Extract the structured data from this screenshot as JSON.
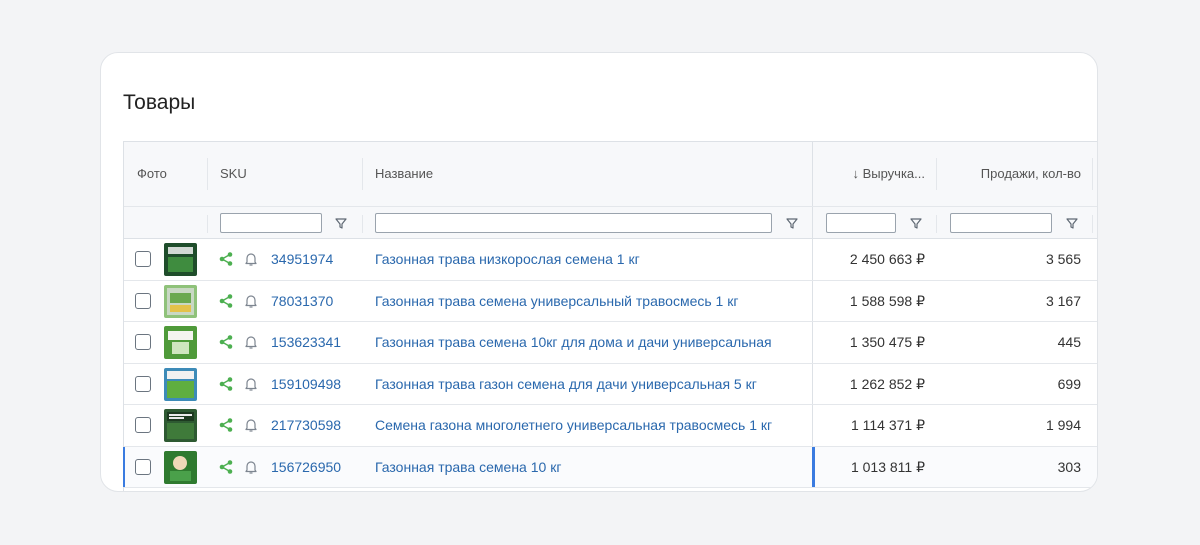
{
  "section": {
    "title": "Товары"
  },
  "columns": {
    "photo": "Фото",
    "sku": "SKU",
    "name": "Название",
    "revenue": "↓ Выручка...",
    "sales": "Продажи, кол-во"
  },
  "filters": {
    "sku": "",
    "name": "",
    "revenue": "",
    "sales": ""
  },
  "icons": {
    "share": "share-icon",
    "bell": "bell-icon",
    "filter": "filter-icon"
  },
  "colors": {
    "link": "#2a68ad",
    "share_icon": "#4caf50",
    "accent": "#3a7be0"
  },
  "rows": [
    {
      "sku": "34951974",
      "name": "Газонная трава низкорослая семена 1 кг",
      "revenue": "2 450 663 ₽",
      "sales": "3 565",
      "thumb_color": "#1f4d2b"
    },
    {
      "sku": "78031370",
      "name": "Газонная трава семена универсальный травосмесь 1 кг",
      "revenue": "1 588 598 ₽",
      "sales": "3 167",
      "thumb_color": "#6aa84f"
    },
    {
      "sku": "153623341",
      "name": "Газонная трава семена 10кг для дома и дачи универсальная",
      "revenue": "1 350 475 ₽",
      "sales": "445",
      "thumb_color": "#4f9a3a"
    },
    {
      "sku": "159109498",
      "name": "Газонная трава газон семена для дачи универсальная 5 кг",
      "revenue": "1 262 852 ₽",
      "sales": "699",
      "thumb_color": "#3d8bb8"
    },
    {
      "sku": "217730598",
      "name": "Семена газона многолетнего универсальная травосмесь 1 кг",
      "revenue": "1 114 371 ₽",
      "sales": "1 994",
      "thumb_color": "#2e5a32"
    },
    {
      "sku": "156726950",
      "name": "Газонная трава семена 10 кг",
      "revenue": "1 013 811 ₽",
      "sales": "303",
      "thumb_color": "#2f7a2f"
    }
  ]
}
